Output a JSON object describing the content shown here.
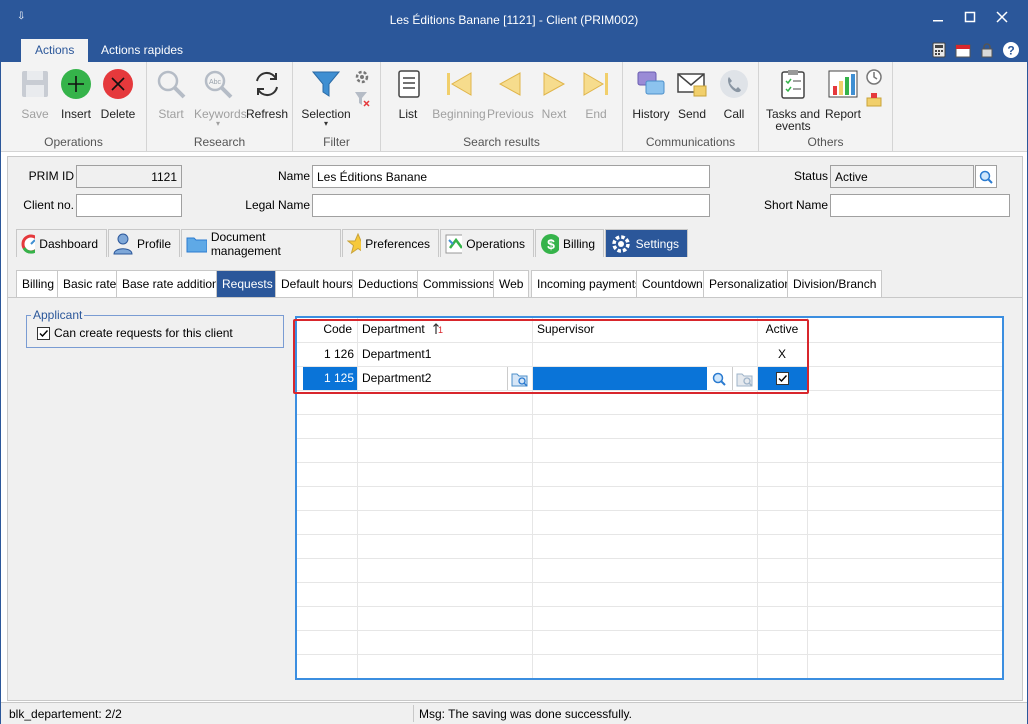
{
  "window": {
    "title": "Les Éditions Banane [1121] - Client (PRIM002)",
    "quick_access": "⇩"
  },
  "ribbon_tabs": [
    "Actions",
    "Actions rapides"
  ],
  "ribbon": {
    "groups": {
      "operations": "Operations",
      "research": "Research",
      "filter": "Filter",
      "search_results": "Search results",
      "communications": "Communications",
      "others": "Others"
    },
    "buttons": {
      "save": "Save",
      "insert": "Insert",
      "delete": "Delete",
      "start": "Start",
      "keywords": "Keywords",
      "refresh": "Refresh",
      "selection": "Selection",
      "list": "List",
      "beginning": "Beginning",
      "previous": "Previous",
      "next": "Next",
      "end": "End",
      "history": "History",
      "send": "Send",
      "call": "Call",
      "tasks_line1": "Tasks and",
      "tasks_line2": "events",
      "report": "Report"
    }
  },
  "form": {
    "prim_id_label": "PRIM ID",
    "prim_id_value": "1121",
    "client_no_label": "Client no.",
    "client_no_value": "",
    "name_label": "Name",
    "name_value": "Les Éditions Banane",
    "legal_name_label": "Legal Name",
    "legal_name_value": "",
    "status_label": "Status",
    "status_value": "Active",
    "short_name_label": "Short Name",
    "short_name_value": ""
  },
  "main_tabs": [
    "Dashboard",
    "Profile",
    "Document management",
    "Preferences",
    "Operations",
    "Billing",
    "Settings"
  ],
  "sub_tabs": [
    "Billing",
    "Basic rate",
    "Base rate addition",
    "Requests",
    "Default hours",
    "Deductions",
    "Commissions",
    "Web",
    "Incoming payments",
    "Countdown",
    "Personalization",
    "Division/Branch"
  ],
  "applicant": {
    "legend": "Applicant",
    "checkbox_label": "Can create requests for this client",
    "checked": true
  },
  "grid": {
    "headers": {
      "code": "Code",
      "department": "Department",
      "sort_indicator": "1",
      "supervisor": "Supervisor",
      "active": "Active"
    },
    "rows": [
      {
        "code": "1 126",
        "department": "Department1",
        "supervisor": "",
        "active": "X"
      },
      {
        "code": "1 125",
        "department": "Department2",
        "supervisor": "",
        "active": "☑"
      }
    ]
  },
  "status_bar": {
    "left": "blk_departement: 2/2",
    "right": "Msg: The saving was done successfully."
  }
}
